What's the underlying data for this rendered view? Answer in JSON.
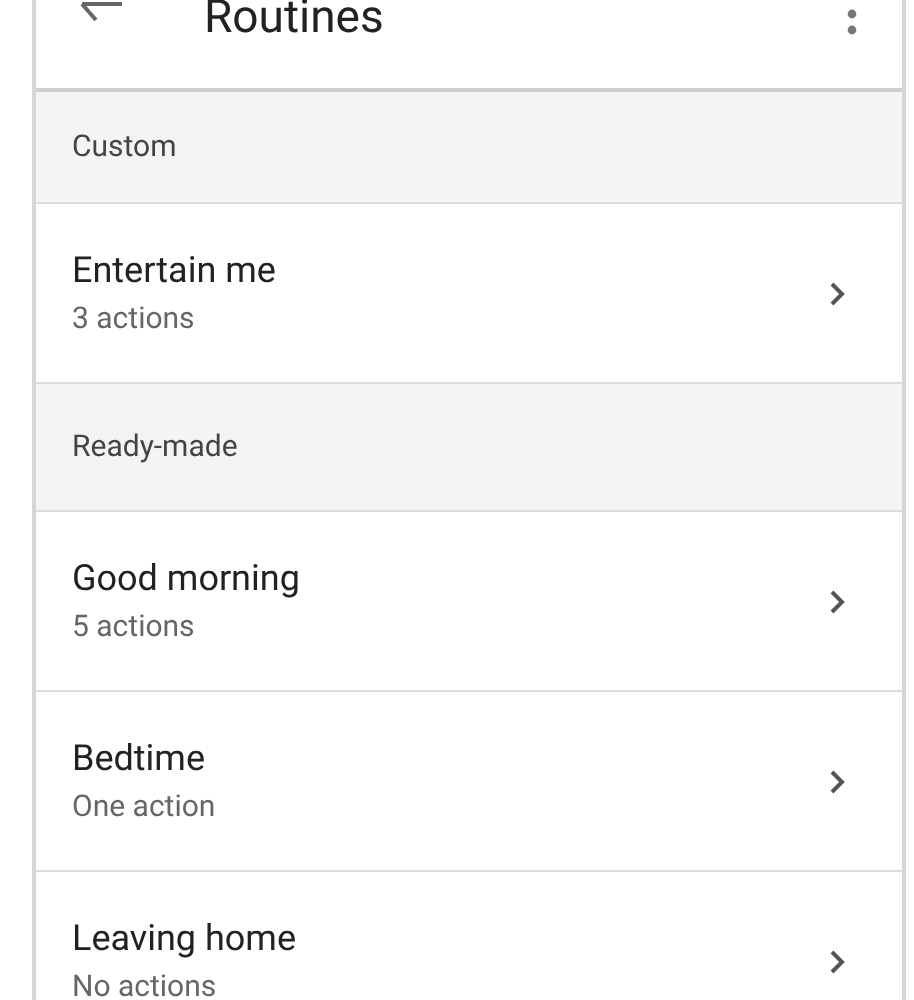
{
  "app_bar": {
    "title": "Routines"
  },
  "sections": [
    {
      "heading": "Custom",
      "items": [
        {
          "name": "Entertain me",
          "detail": "3 actions"
        }
      ]
    },
    {
      "heading": "Ready-made",
      "items": [
        {
          "name": "Good morning",
          "detail": "5 actions"
        },
        {
          "name": "Bedtime",
          "detail": "One action"
        },
        {
          "name": "Leaving home",
          "detail": "No actions"
        }
      ]
    }
  ]
}
